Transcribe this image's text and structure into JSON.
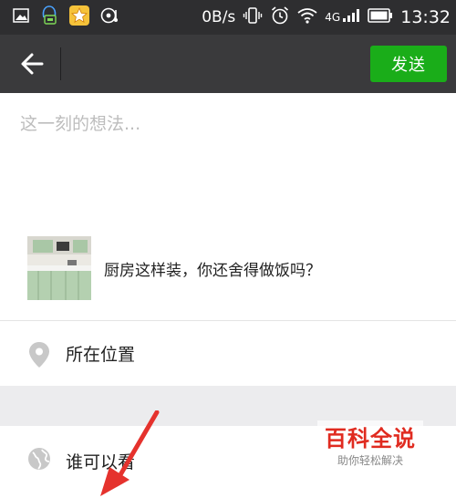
{
  "status_bar": {
    "network_speed": "0B/s",
    "network_type": "4G",
    "time": "13:32",
    "icons": [
      "gallery-icon",
      "qq-icon",
      "star-app-icon",
      "music-icon",
      "vibrate-icon",
      "alarm-icon",
      "wifi-icon",
      "signal-icon",
      "battery-icon"
    ]
  },
  "app_bar": {
    "back_icon": "back-arrow-icon",
    "send_label": "发送",
    "send_color": "#1aad19"
  },
  "composer": {
    "placeholder": "这一刻的想法...",
    "value": ""
  },
  "link_card": {
    "title": "厨房这样装，你还舍得做饭吗？",
    "thumbnail": "kitchen-thumbnail"
  },
  "options": {
    "location_label": "所在位置",
    "location_icon": "location-pin-icon",
    "visibility_label": "谁可以看",
    "visibility_icon": "globe-icon"
  },
  "watermark": {
    "title": "百科全说",
    "subtitle": "助你轻松解决",
    "color": "#e02b20"
  },
  "annotation": {
    "arrow_color": "#e5322d"
  }
}
